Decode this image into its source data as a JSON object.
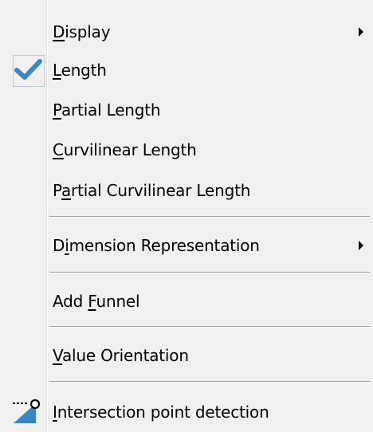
{
  "menu": {
    "items": [
      {
        "label_pre": "",
        "label_mn": "D",
        "label_post": "isplay",
        "submenu": true
      },
      {
        "label_pre": "",
        "label_mn": "L",
        "label_post": "ength",
        "checked": true
      },
      {
        "label_pre": "",
        "label_mn": "P",
        "label_post": "artial Length"
      },
      {
        "label_pre": "",
        "label_mn": "C",
        "label_post": "urvilinear Length"
      },
      {
        "label_pre": "P",
        "label_mn": "a",
        "label_post": "rtial Curvilinear Length"
      },
      {
        "label_pre": "D",
        "label_mn": "i",
        "label_post": "mension Representation",
        "submenu": true
      },
      {
        "label_pre": "Add ",
        "label_mn": "F",
        "label_post": "unnel"
      },
      {
        "label_pre": "",
        "label_mn": "V",
        "label_post": "alue Orientation"
      },
      {
        "label_pre": "",
        "label_mn": "I",
        "label_post": "ntersection point detection",
        "icon": "intersection-point-icon"
      }
    ]
  },
  "colors": {
    "menu_bg": "#f0f0f0",
    "check_blue": "#3a85c4",
    "separator": "#a0a0a0"
  }
}
